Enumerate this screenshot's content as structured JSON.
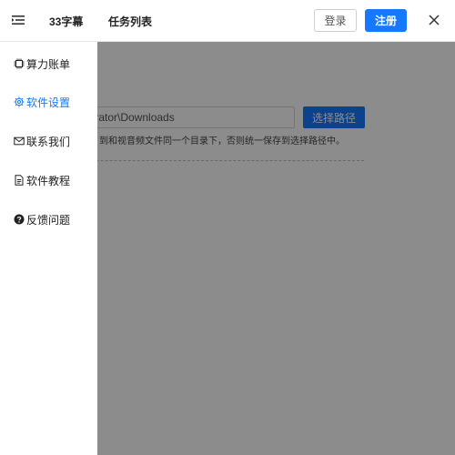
{
  "header": {
    "app_title": "33字幕",
    "task_list": "任务列表",
    "login_label": "登录",
    "register_label": "注册",
    "brand_color": "#1677ff"
  },
  "drawer": {
    "items": [
      {
        "label": "算力账单",
        "icon": "chip-icon",
        "active": false
      },
      {
        "label": "软件设置",
        "icon": "gear-icon",
        "active": true
      },
      {
        "label": "联系我们",
        "icon": "mail-icon",
        "active": false
      },
      {
        "label": "软件教程",
        "icon": "document-icon",
        "active": false
      },
      {
        "label": "反馈问题",
        "icon": "question-icon",
        "active": false
      }
    ]
  },
  "settings": {
    "download_path_value": "trator\\Downloads",
    "choose_path_label": "选择路径",
    "hint_visible": "到和视音频文件同一个目录下，否则统一保存到选择路径中。"
  }
}
